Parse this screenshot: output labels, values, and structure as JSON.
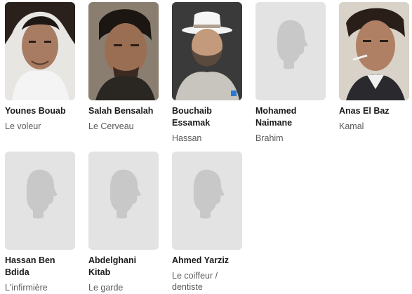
{
  "cast": [
    {
      "name": "Younes Bouab",
      "role": "Le voleur",
      "photo": "portrait-photo",
      "tone": "#3a2e28"
    },
    {
      "name": "Salah Bensalah",
      "role": "Le Cerveau",
      "photo": "portrait-photo",
      "tone": "#4a3a30"
    },
    {
      "name": "Bouchaib Essamak",
      "role": "Hassan",
      "photo": "portrait-photo",
      "tone": "#5a4a3c"
    },
    {
      "name": "Mohamed Naimane",
      "role": "Brahim",
      "photo": "placeholder-silhouette",
      "tone": "#c8c8c8"
    },
    {
      "name": "Anas El Baz",
      "role": "Kamal",
      "photo": "portrait-photo",
      "tone": "#6a4a38"
    },
    {
      "name": "Hassan Ben Bdida",
      "role": "L'infirmière",
      "photo": "placeholder-silhouette",
      "tone": "#c8c8c8"
    },
    {
      "name": "Abdelghani Kitab",
      "role": "Le garde",
      "photo": "placeholder-silhouette",
      "tone": "#c8c8c8"
    },
    {
      "name": "Ahmed Yarziz",
      "role": "Le coiffeur / dentiste",
      "photo": "placeholder-silhouette",
      "tone": "#c8c8c8"
    }
  ]
}
